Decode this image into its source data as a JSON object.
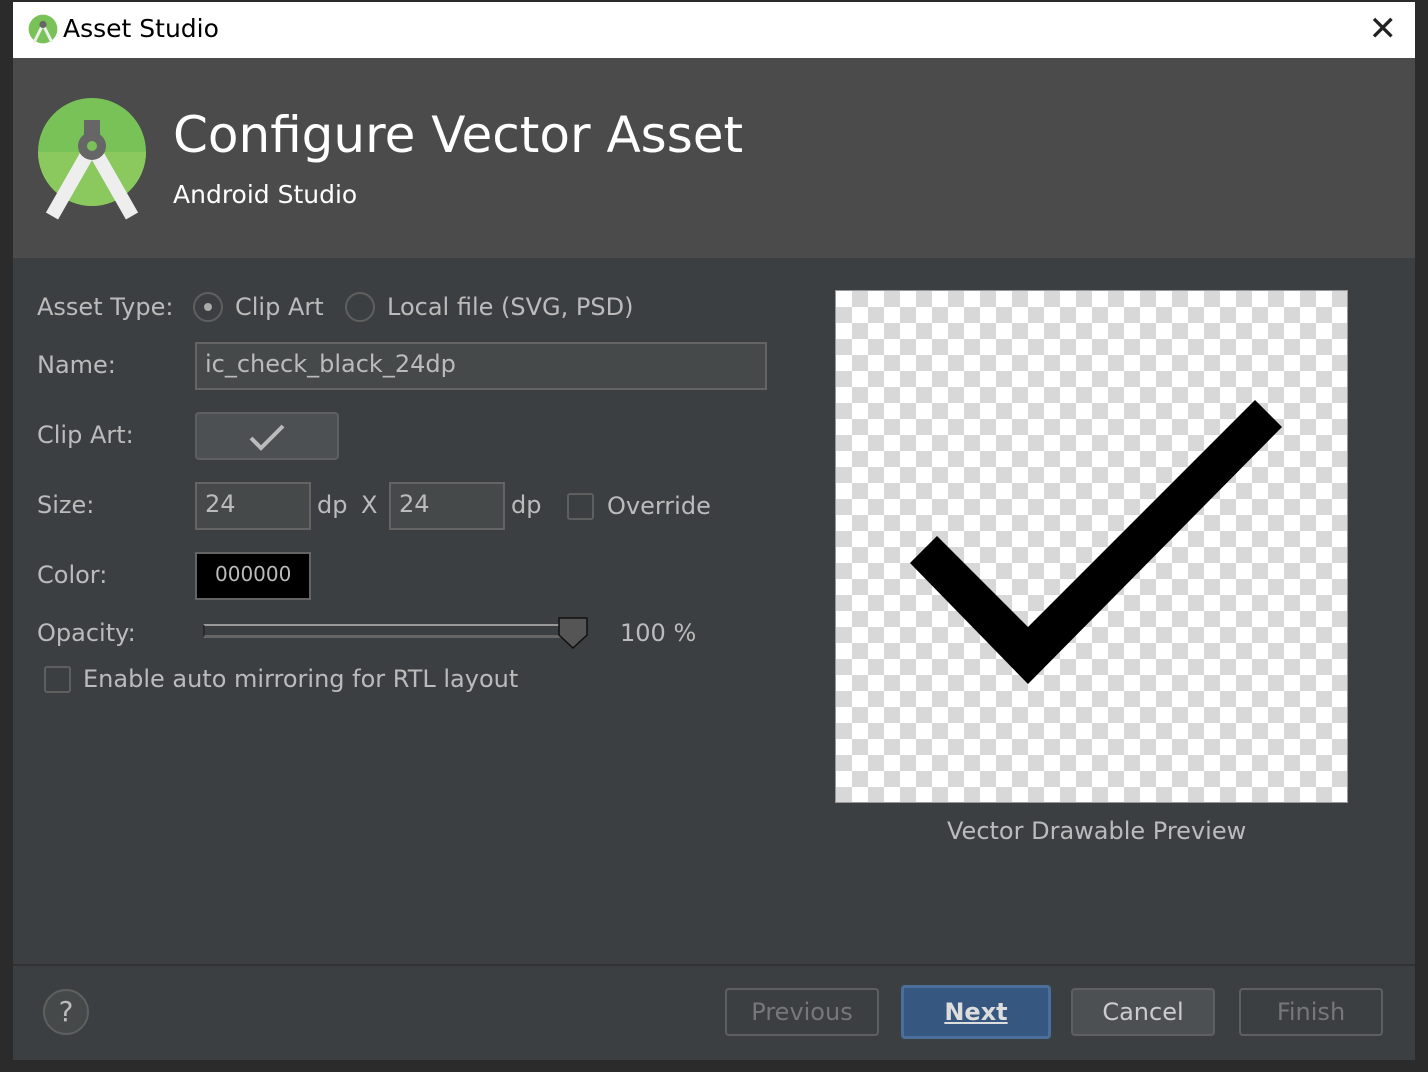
{
  "window": {
    "title": "Asset Studio",
    "close_icon": "close-icon"
  },
  "header": {
    "title": "Configure Vector Asset",
    "subtitle": "Android Studio",
    "logo": "android-studio-logo"
  },
  "form": {
    "asset_type_label": "Asset Type:",
    "asset_type_options": [
      {
        "label": "Clip Art",
        "selected": true
      },
      {
        "label": "Local file (SVG, PSD)",
        "selected": false
      }
    ],
    "name_label": "Name:",
    "name_value": "ic_check_black_24dp",
    "clip_art_label": "Clip Art:",
    "clip_art_icon": "check-icon",
    "size_label": "Size:",
    "width_value": "24",
    "width_unit": "dp",
    "times": "X",
    "height_value": "24",
    "height_unit": "dp",
    "override_label": "Override",
    "override_checked": false,
    "color_label": "Color:",
    "color_value": "000000",
    "color_hex": "#000000",
    "opacity_label": "Opacity:",
    "opacity_percent": 100,
    "opacity_text": "100 %",
    "mirroring_label": "Enable auto mirroring for RTL layout",
    "mirroring_checked": false
  },
  "preview": {
    "caption": "Vector Drawable Preview"
  },
  "footer": {
    "help": "?",
    "previous": "Previous",
    "next": "Next",
    "cancel": "Cancel",
    "finish": "Finish",
    "accent": "#365880"
  }
}
